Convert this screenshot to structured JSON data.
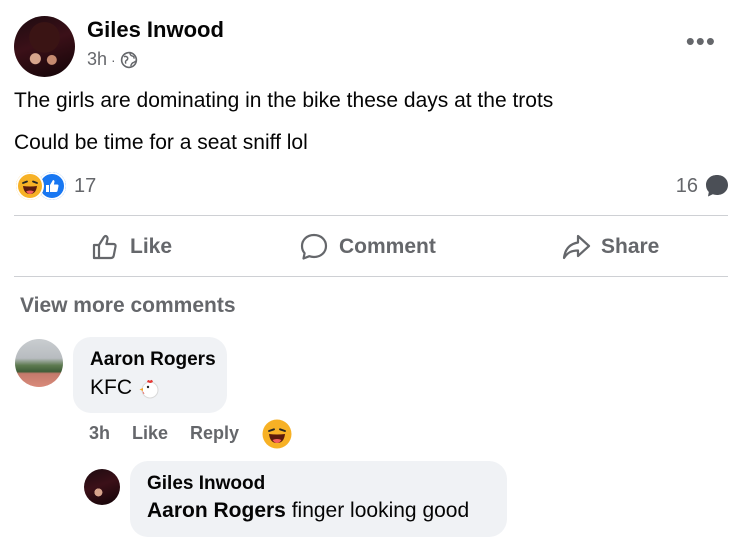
{
  "post": {
    "author": "Giles Inwood",
    "time": "3h",
    "separator": "·",
    "audience_icon": "globe-icon",
    "more_icon": "more-options-icon",
    "body_lines": [
      "The girls are dominating in the bike these days at the trots",
      "Could be time for a seat sniff lol"
    ],
    "reactions": {
      "types": [
        "haha",
        "like"
      ],
      "count": "17"
    },
    "comments_count": "16"
  },
  "actions": {
    "like": "Like",
    "comment": "Comment",
    "share": "Share"
  },
  "comments_section": {
    "view_more": "View more comments",
    "comments": [
      {
        "author": "Aaron Rogers",
        "text": "KFC",
        "emoji": "chicken-icon",
        "time": "3h",
        "like_label": "Like",
        "reply_label": "Reply",
        "reaction": "haha"
      }
    ],
    "reply": {
      "author": "Giles Inwood",
      "mention": "Aaron Rogers",
      "text": " finger looking good"
    }
  },
  "colors": {
    "secondary_text": "#65676b",
    "bubble_bg": "#f0f2f5",
    "like_blue": "#1877f2",
    "haha_yellow": "#f7b125",
    "divider": "#ced0d4"
  }
}
